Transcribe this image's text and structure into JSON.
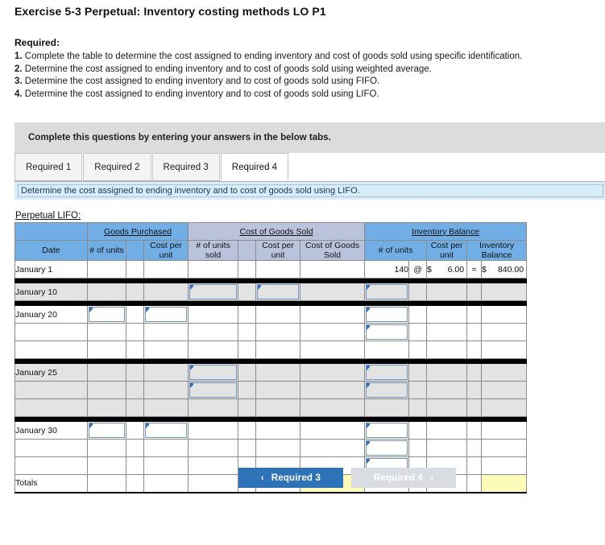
{
  "title": "Exercise 5-3 Perpetual: Inventory costing methods LO P1",
  "required": {
    "heading": "Required:",
    "items": [
      {
        "num": "1.",
        "text": "Complete the table to determine the cost assigned to ending inventory and cost of goods sold using specific identification."
      },
      {
        "num": "2.",
        "text": "Determine the cost assigned to ending inventory and to cost of goods sold using weighted average."
      },
      {
        "num": "3.",
        "text": "Determine the cost assigned to ending inventory and to cost of goods sold using FIFO."
      },
      {
        "num": "4.",
        "text": "Determine the cost assigned to ending inventory and to cost of goods sold using LIFO."
      }
    ]
  },
  "instruction_bar": "Complete this questions by entering your answers in the below tabs.",
  "tabs": [
    {
      "label": "Required 1",
      "active": false
    },
    {
      "label": "Required 2",
      "active": false
    },
    {
      "label": "Required 3",
      "active": false
    },
    {
      "label": "Required 4",
      "active": true
    }
  ],
  "sub_instruction": "Determine the cost assigned to ending inventory and to cost of goods sold using LIFO.",
  "table": {
    "caption": "Perpetual LIFO:",
    "groups": {
      "date": "",
      "goods_purchased": "Goods Purchased",
      "cost_of_goods_sold": "Cost of Goods Sold",
      "inventory_balance": "Inventory Balance"
    },
    "headers": {
      "date": "Date",
      "gp_units": "# of units",
      "gp_blank": "",
      "gp_cost_per_unit": "Cost per unit",
      "cogs_units_sold": "# of units sold",
      "cogs_cost_per_unit": "Cost per unit",
      "cogs_total": "Cost of Goods Sold",
      "ib_units": "# of units",
      "ib_cost_per_unit": "Cost per unit",
      "ib_balance": "Inventory Balance"
    },
    "rows": [
      {
        "date": "January 1",
        "ib_units": "140",
        "ib_at": "@",
        "ib_cost_symbol": "$",
        "ib_cost": "6.00",
        "ib_eq": "=",
        "ib_balance_symbol": "$",
        "ib_balance": "840.00"
      },
      {
        "date": "January 10"
      },
      {
        "date": "January 20"
      },
      {
        "date": ""
      },
      {
        "date": ""
      },
      {
        "date": "January 25"
      },
      {
        "date": ""
      },
      {
        "date": ""
      },
      {
        "date": "January 30"
      },
      {
        "date": ""
      },
      {
        "date": ""
      },
      {
        "date": "Totals"
      }
    ]
  },
  "nav": {
    "prev_label": "Required 3",
    "prev_chevron": "‹",
    "next_label": "Required 4",
    "next_chevron": "›"
  },
  "colors": {
    "header_blue": "#72aee6",
    "header_slate": "#b9c4dc",
    "row_grey": "#e3e3e3",
    "yellow_cell": "#fdfbb9",
    "primary_button": "#2e72b8",
    "disabled_button": "#d9dde2",
    "info_bar": "#d9edf9",
    "grey_bar": "#dcdcdc"
  }
}
